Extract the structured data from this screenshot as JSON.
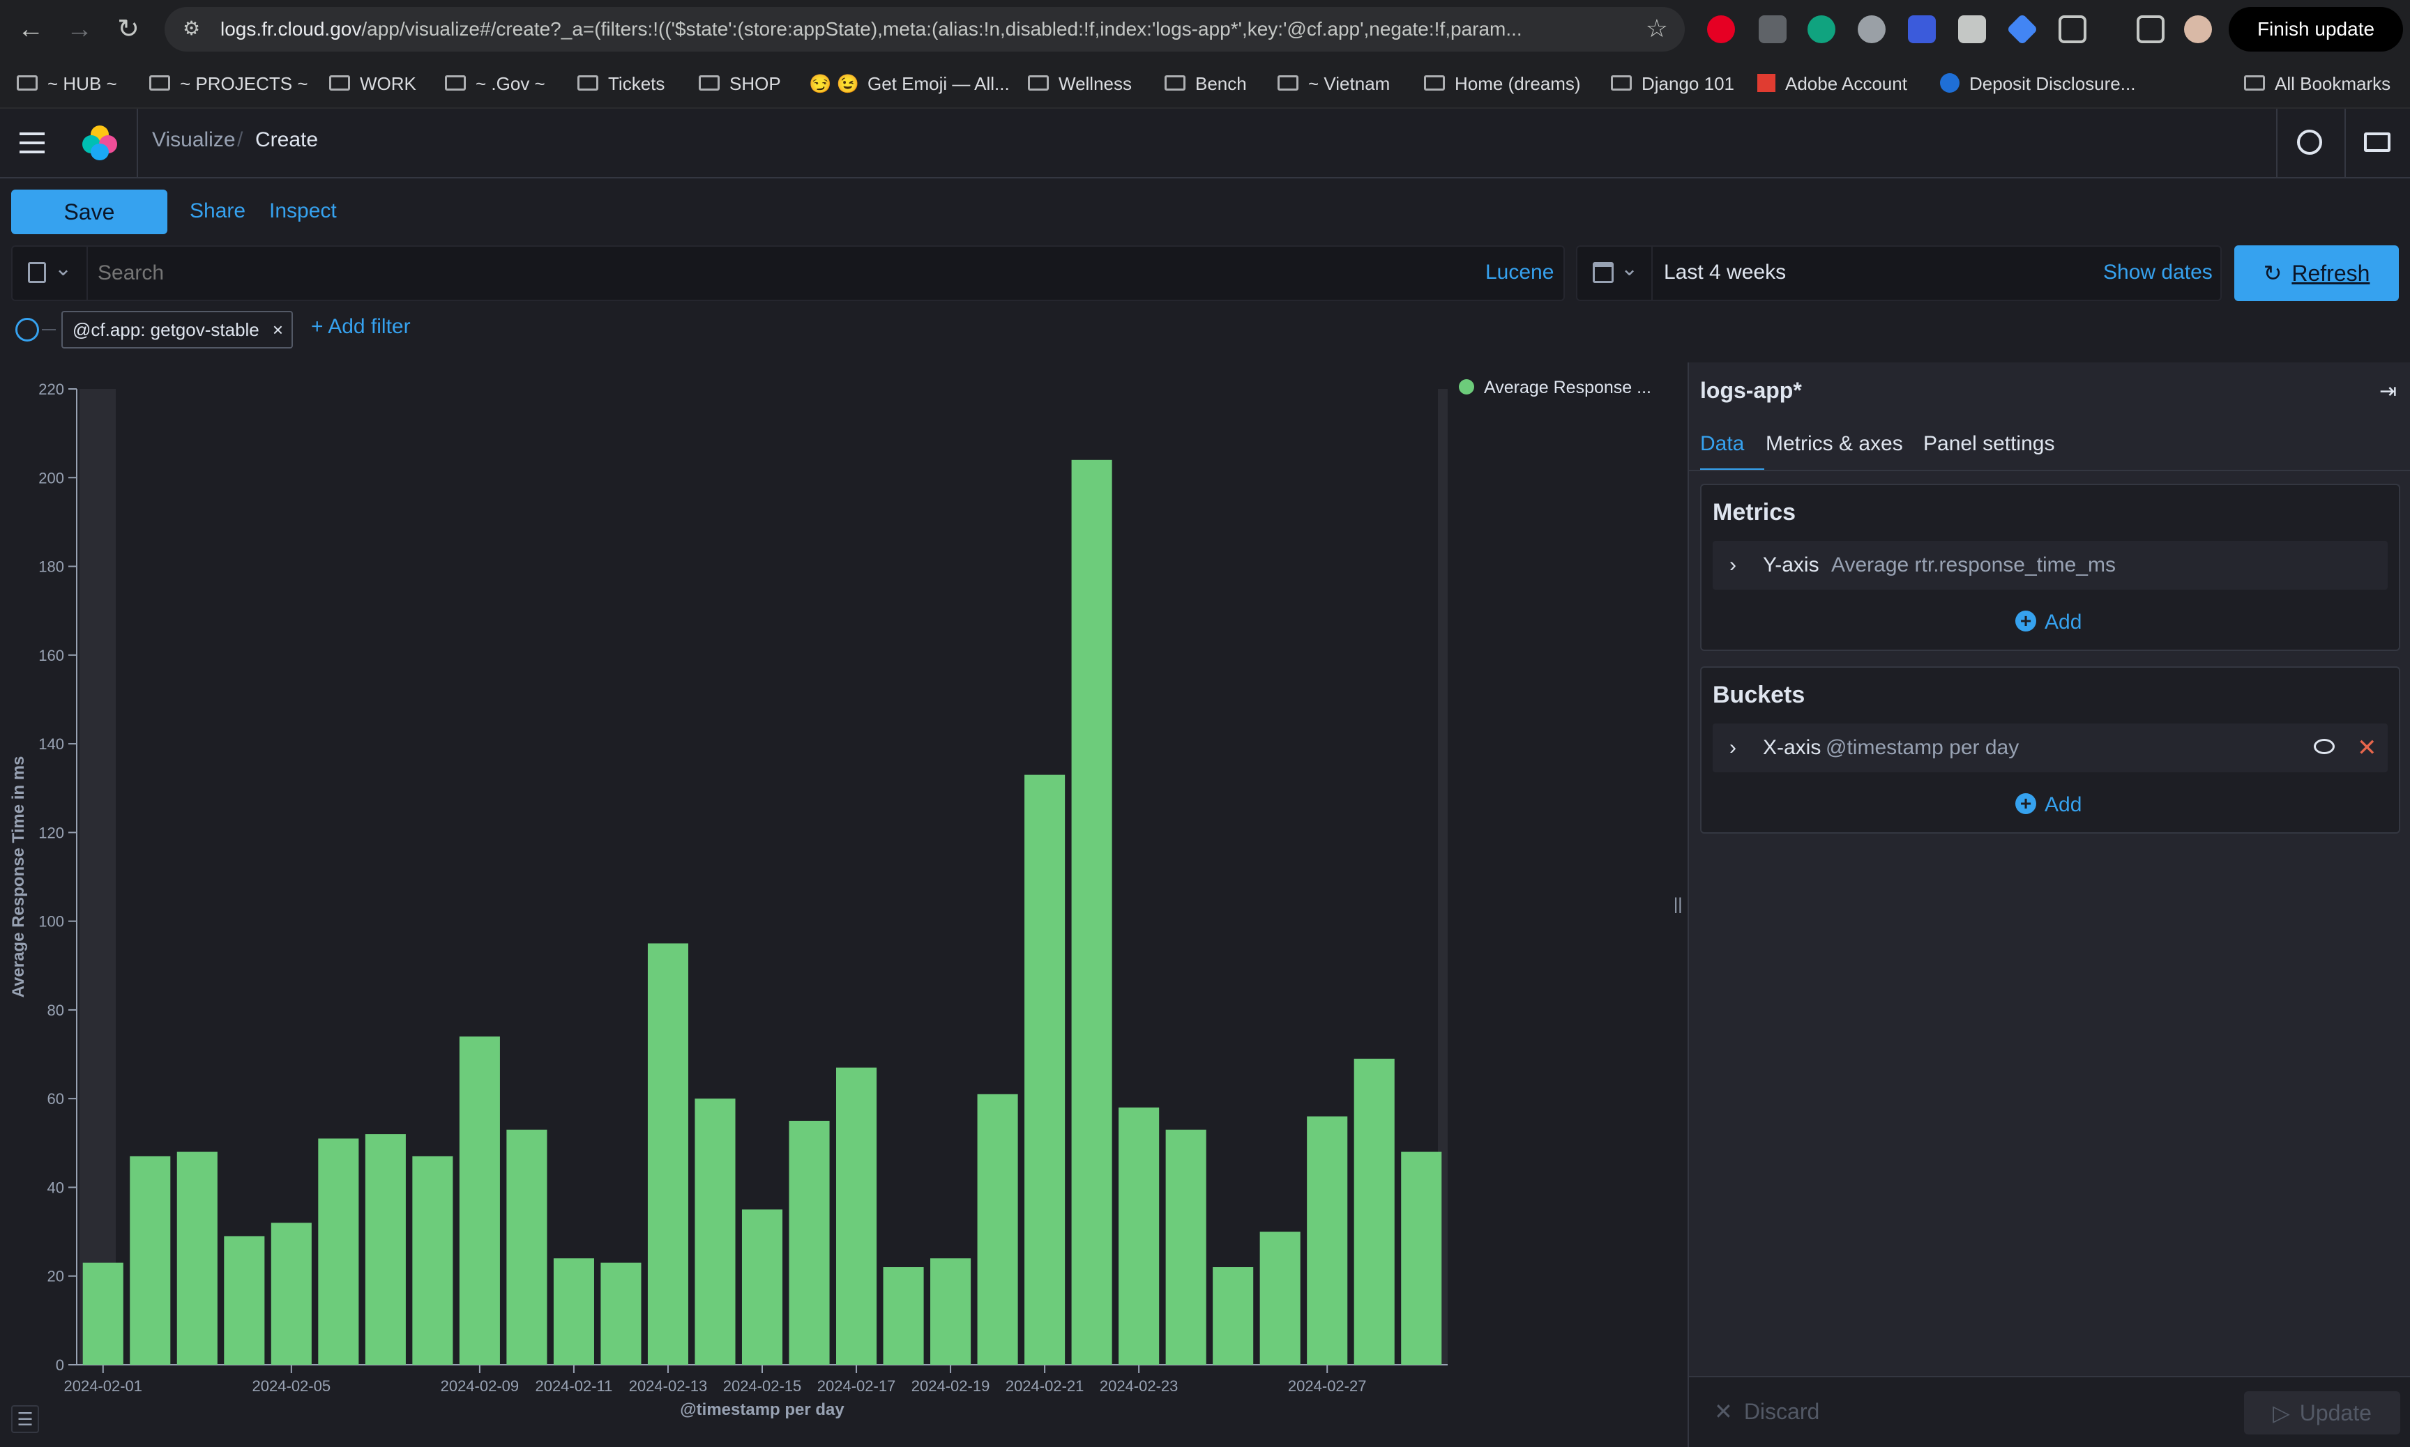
{
  "browser": {
    "url_host": "logs.fr.cloud.gov",
    "url_path": "/app/visualize#/create?_a=(filters:!(('$state':(store:appState),meta:(alias:!n,disabled:!f,index:'logs-app*',key:'@cf.app',negate:!f,param...",
    "finish_update": "Finish update"
  },
  "bookmarks": [
    "~ HUB ~",
    "~ PROJECTS ~",
    "WORK",
    "~ .Gov ~",
    "Tickets",
    "SHOP",
    "Get Emoji — All...",
    "Wellness",
    "Bench",
    "~ Vietnam",
    "Home (dreams)",
    "Django 101",
    "Adobe Account",
    "Deposit Disclosure...",
    "All Bookmarks"
  ],
  "bookmark_emoji": "😏 😉",
  "header": {
    "breadcrumb_root": "Visualize",
    "breadcrumb_sep": "/",
    "breadcrumb_current": "Create"
  },
  "toolbar": {
    "save": "Save",
    "share": "Share",
    "inspect": "Inspect"
  },
  "query": {
    "placeholder": "Search",
    "language": "Lucene",
    "date_range": "Last 4 weeks",
    "show_dates": "Show dates",
    "refresh": "Refresh"
  },
  "filters": {
    "pill": "@cf.app: getgov-stable",
    "pill_close": "×",
    "add_filter": "+ Add filter"
  },
  "legend": {
    "label": "Average Response ..."
  },
  "sidebar": {
    "index": "logs-app*",
    "tabs": [
      "Data",
      "Metrics & axes",
      "Panel settings"
    ],
    "metrics_title": "Metrics",
    "metric_axis": "Y-axis",
    "metric_desc": "Average rtr.response_time_ms",
    "buckets_title": "Buckets",
    "bucket_axis": "X-axis",
    "bucket_desc": "@timestamp per day",
    "add": "Add",
    "discard": "Discard",
    "update": "Update"
  },
  "chart_data": {
    "type": "bar",
    "xlabel": "@timestamp per day",
    "ylabel": "Average Response Time in ms",
    "ylim": [
      0,
      220
    ],
    "yticks": [
      0,
      20,
      40,
      60,
      80,
      100,
      120,
      140,
      160,
      180,
      200,
      220
    ],
    "xticks": [
      "2024-02-01",
      "2024-02-05",
      "2024-02-09",
      "2024-02-11",
      "2024-02-13",
      "2024-02-15",
      "2024-02-17",
      "2024-02-19",
      "2024-02-21",
      "2024-02-23",
      "2024-02-27"
    ],
    "categories": [
      "2024-02-01",
      "2024-02-02",
      "2024-02-03",
      "2024-02-04",
      "2024-02-05",
      "2024-02-06",
      "2024-02-07",
      "2024-02-08",
      "2024-02-09",
      "2024-02-10",
      "2024-02-11",
      "2024-02-12",
      "2024-02-13",
      "2024-02-14",
      "2024-02-15",
      "2024-02-16",
      "2024-02-17",
      "2024-02-18",
      "2024-02-19",
      "2024-02-20",
      "2024-02-21",
      "2024-02-22",
      "2024-02-23",
      "2024-02-24",
      "2024-02-25",
      "2024-02-26",
      "2024-02-27",
      "2024-02-28",
      "2024-02-29"
    ],
    "series": [
      {
        "values": [
          23,
          47,
          48,
          29,
          32,
          51,
          52,
          47,
          74,
          53,
          24,
          23,
          95,
          60,
          35,
          55,
          67,
          22,
          24,
          61,
          133,
          204,
          58,
          53,
          22,
          30,
          56,
          69,
          48
        ],
        "color": "#6dcc7b"
      }
    ],
    "grid": false,
    "legend_position": "top-right"
  }
}
